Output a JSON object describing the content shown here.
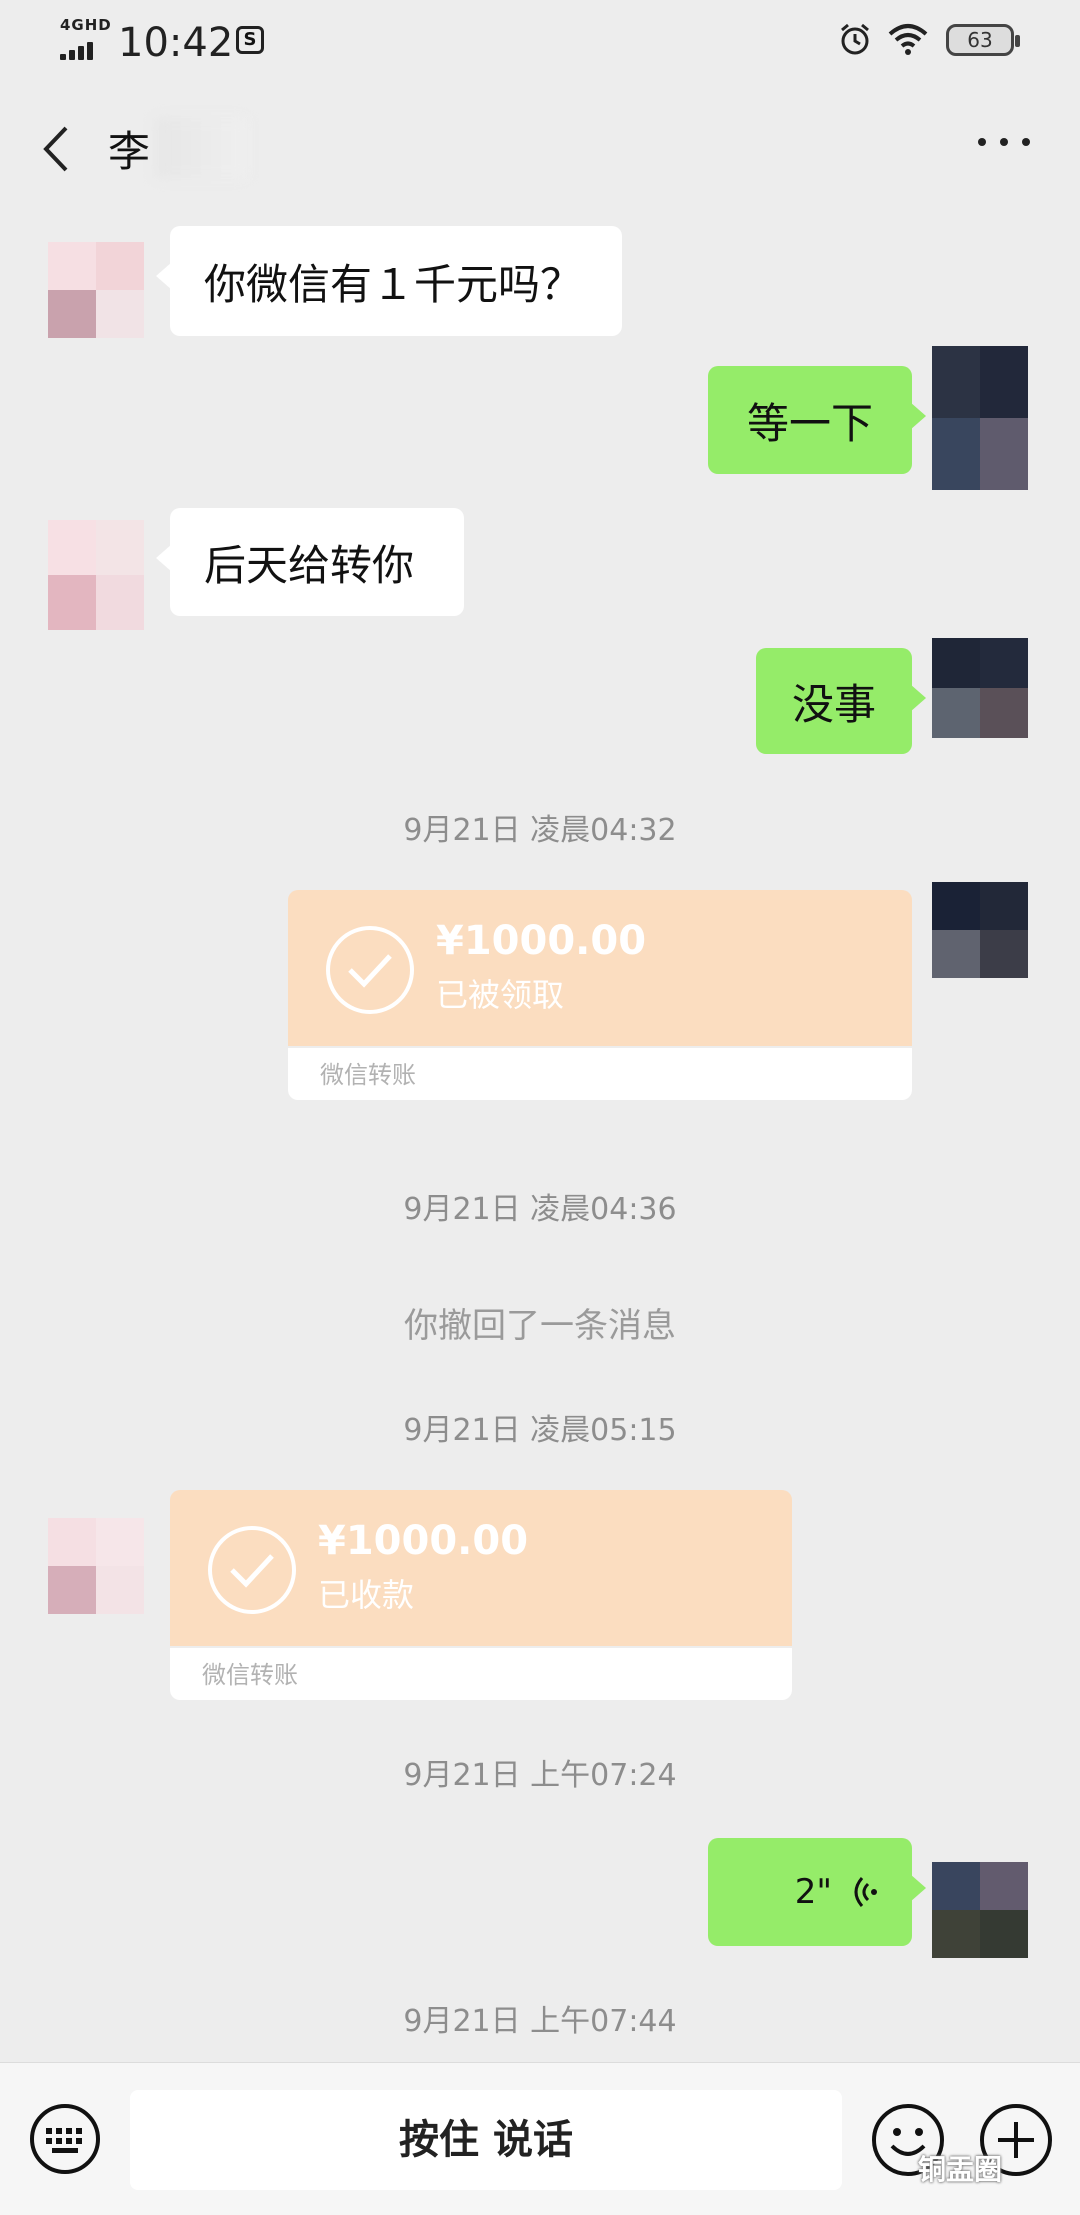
{
  "status_bar": {
    "network": "4GHD",
    "time": "10:42",
    "app_badge": "S",
    "battery": "63"
  },
  "header": {
    "back_icon": "chevron-left-icon",
    "title": "李",
    "menu_icon": "more-dots-icon"
  },
  "messages": [
    {
      "type": "text",
      "side": "left",
      "text": "你微信有１千元吗？"
    },
    {
      "type": "text",
      "side": "right",
      "text": "等一下"
    },
    {
      "type": "text",
      "side": "left",
      "text": "后天给转你"
    },
    {
      "type": "text",
      "side": "right",
      "text": "没事"
    },
    {
      "type": "timestamp",
      "text": "9月21日 凌晨04:32"
    },
    {
      "type": "transfer",
      "side": "right",
      "amount": "¥1000.00",
      "status": "已被领取",
      "label": "微信转账"
    },
    {
      "type": "timestamp",
      "text": "9月21日 凌晨04:36"
    },
    {
      "type": "system",
      "text": "你撤回了一条消息"
    },
    {
      "type": "timestamp",
      "text": "9月21日 凌晨05:15"
    },
    {
      "type": "transfer",
      "side": "left",
      "amount": "¥1000.00",
      "status": "已收款",
      "label": "微信转账"
    },
    {
      "type": "timestamp",
      "text": "9月21日 上午07:24"
    },
    {
      "type": "voice",
      "side": "right",
      "duration": "2\""
    },
    {
      "type": "timestamp",
      "text": "9月21日 上午07:44"
    }
  ],
  "input_bar": {
    "keyboard_icon": "keyboard-icon",
    "hold_to_talk": "按住 说话",
    "emoji_icon": "emoji-icon",
    "plus_icon": "plus-icon"
  },
  "watermark": "铜盂圈",
  "colors": {
    "background": "#ededed",
    "sent_bubble": "#95ec69",
    "received_bubble": "#ffffff",
    "transfer_card": "#fbddc0"
  }
}
